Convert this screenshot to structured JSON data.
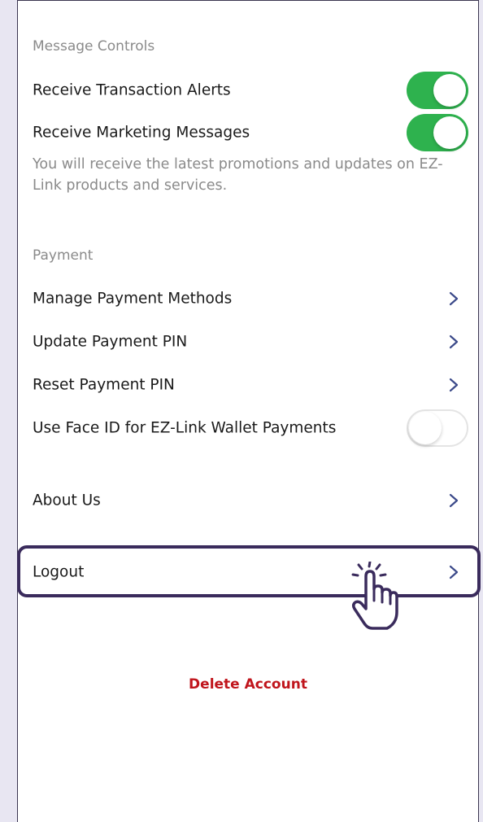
{
  "message_controls": {
    "title": "Message Controls",
    "transaction_alerts": {
      "label": "Receive Transaction Alerts",
      "state": "on"
    },
    "marketing_messages": {
      "label": "Receive Marketing Messages",
      "state": "on"
    },
    "description": "You will receive the latest promotions and updates on EZ-Link products and services."
  },
  "payment": {
    "title": "Payment",
    "items": [
      {
        "label": "Manage Payment Methods"
      },
      {
        "label": "Update Payment PIN"
      },
      {
        "label": "Reset Payment PIN"
      }
    ],
    "face_id": {
      "label": "Use Face ID for EZ-Link Wallet Payments",
      "state": "off"
    }
  },
  "about_us": {
    "label": "About Us"
  },
  "logout": {
    "label": "Logout"
  },
  "delete_account": {
    "label": "Delete Account"
  },
  "colors": {
    "toggle_on": "#2eb24e",
    "delete_red": "#c0151c",
    "highlight_purple": "#3a2b5c",
    "chevron_blue": "#3c4a8a"
  },
  "icons": {
    "chevron": "chevron-right-icon",
    "pointer": "hand-pointer-icon"
  }
}
